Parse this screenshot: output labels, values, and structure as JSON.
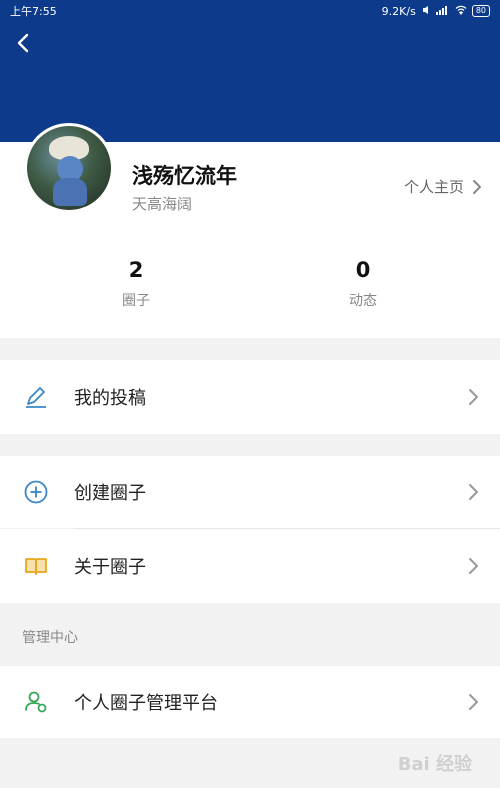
{
  "status_bar": {
    "time": "上午7:55",
    "network_speed": "9.2K/s",
    "battery": "80"
  },
  "profile": {
    "username": "浅殇忆流年",
    "signature": "天高海阔",
    "homepage_label": "个人主页"
  },
  "stats": [
    {
      "value": "2",
      "label": "圈子"
    },
    {
      "value": "0",
      "label": "动态"
    }
  ],
  "menu": {
    "my_posts": "我的投稿",
    "create_circle": "创建圈子",
    "about_circle": "关于圈子",
    "admin_section_title": "管理中心",
    "personal_admin_platform": "个人圈子管理平台"
  },
  "watermark": "Bai 经验",
  "colors": {
    "header": "#0d3a8a",
    "accent_blue": "#3a86c8",
    "accent_yellow": "#e6a817",
    "accent_green": "#3aa85a"
  }
}
